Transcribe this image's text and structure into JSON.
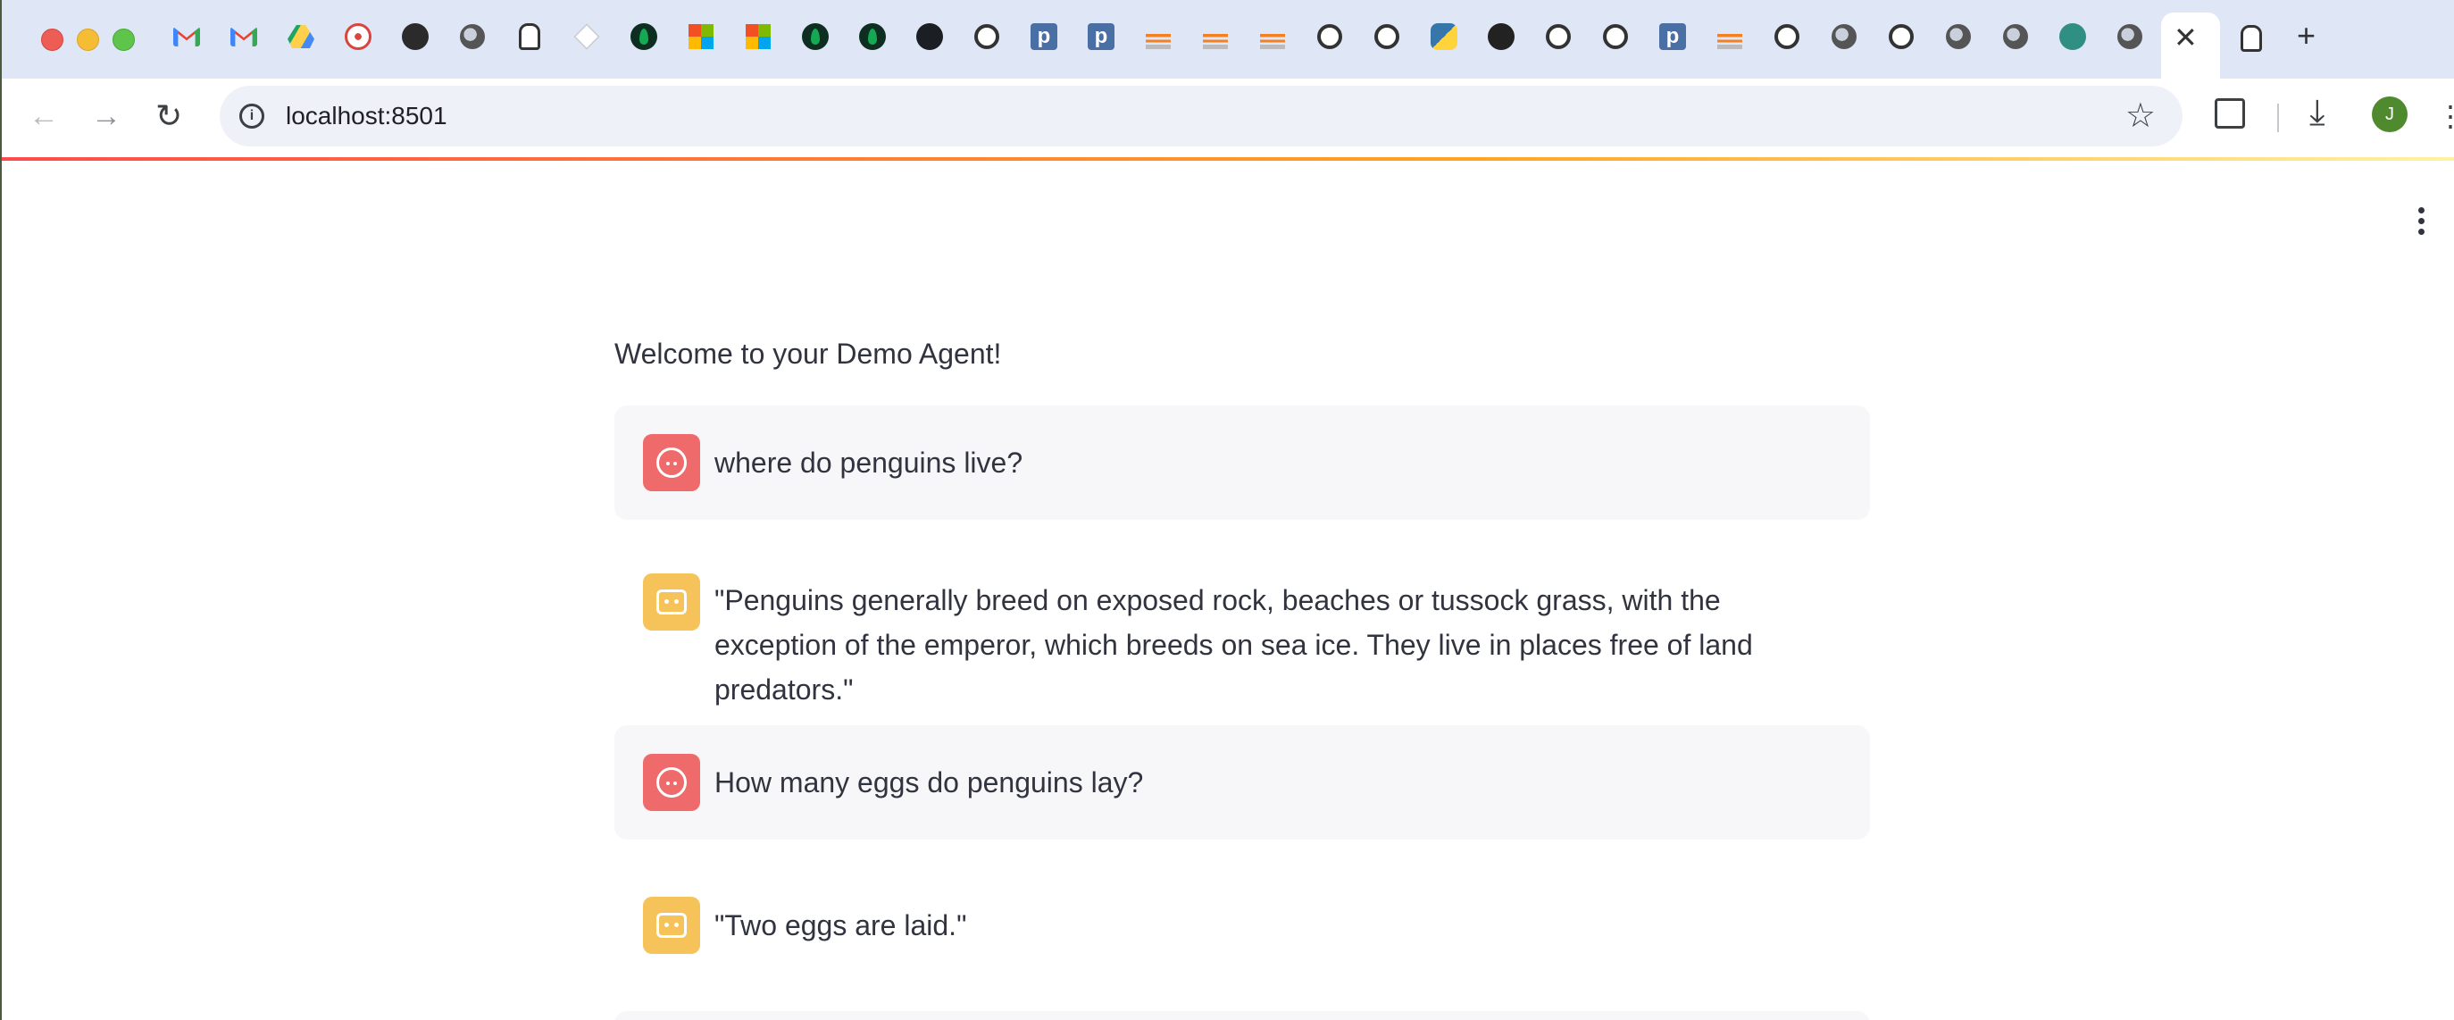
{
  "browser": {
    "tab_icons": [
      "gmail-icon",
      "gmail-icon",
      "google-drive-icon",
      "red-circle-icon",
      "dark-circle-icon",
      "globe-icon",
      "llama-icon",
      "cube-icon",
      "mongodb-icon",
      "microsoft-icon",
      "microsoft-icon",
      "mongodb-icon",
      "mongodb-icon",
      "github-icon",
      "openai-icon",
      "p-icon",
      "p-icon",
      "stackoverflow-icon",
      "stackoverflow-icon",
      "stackoverflow-icon",
      "openai-icon",
      "openai-icon",
      "python-icon",
      "crown-icon",
      "openai-icon",
      "openai-icon",
      "p-icon",
      "stackoverflow-icon",
      "openai-icon",
      "globe-icon",
      "openai-icon",
      "globe-icon",
      "globe-icon",
      "teal-icon",
      "globe-icon"
    ],
    "active_tab_icon": "llama-icon",
    "url": "localhost:8501",
    "profile_initial": "J",
    "p_glyph": "p"
  },
  "app": {
    "welcome": "Welcome to your Demo Agent!",
    "messages": [
      {
        "role": "user",
        "text": "where do penguins live?"
      },
      {
        "role": "assistant",
        "text": "\"Penguins generally breed on exposed rock, beaches or tussock grass, with the exception of the emperor, which breeds on sea ice. They live in places free of land predators.\""
      },
      {
        "role": "user",
        "text": "How many eggs do penguins lay?"
      },
      {
        "role": "assistant",
        "text": "\"Two eggs are laid.\""
      }
    ]
  },
  "colors": {
    "user_avatar": "#ef6b6b",
    "assistant_avatar": "#f6c25a",
    "user_bubble": "#f7f7f9",
    "text": "#31333f"
  }
}
